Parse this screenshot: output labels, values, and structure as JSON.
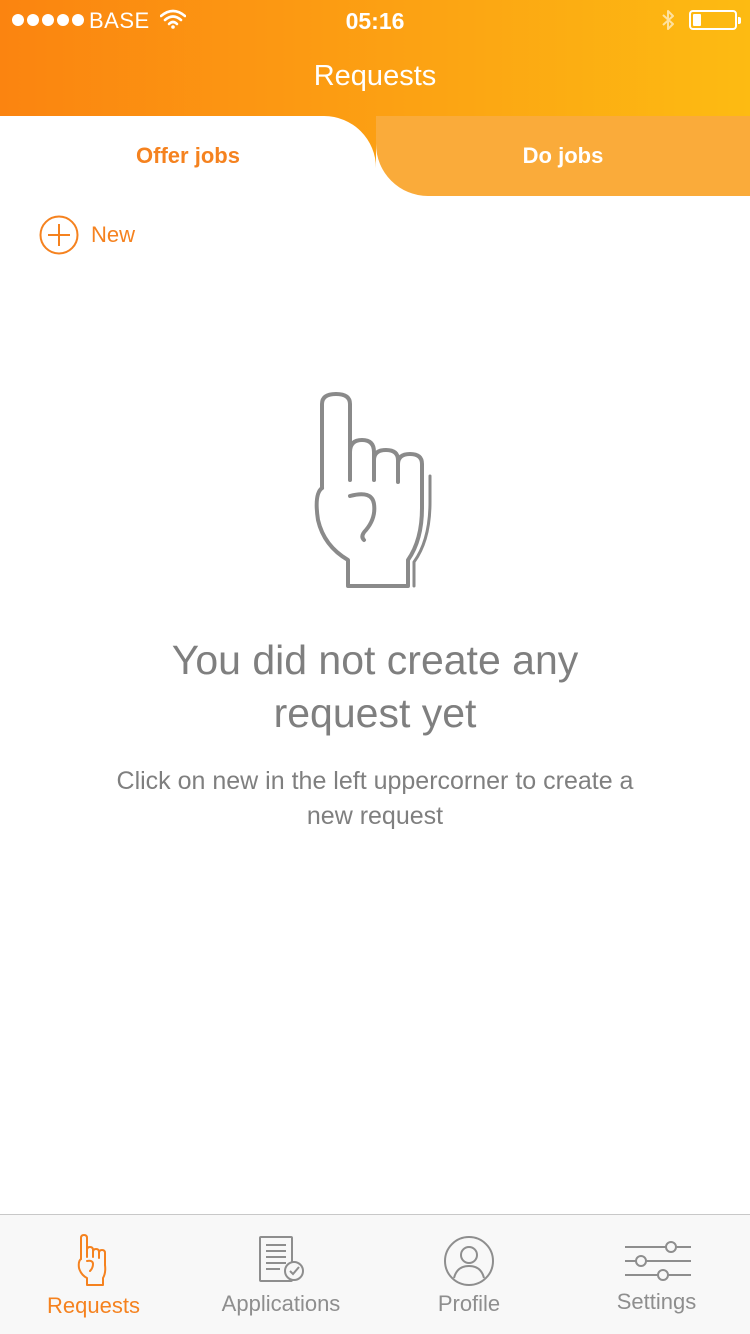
{
  "status_bar": {
    "carrier": "BASE",
    "time": "05:16",
    "battery_level": 0.2
  },
  "header": {
    "title": "Requests"
  },
  "tabs": [
    {
      "label": "Offer jobs",
      "active": true
    },
    {
      "label": "Do jobs",
      "active": false
    }
  ],
  "toolbar": {
    "new_label": "New",
    "new_icon": "plus-circle-icon"
  },
  "empty_state": {
    "icon": "pointing-hand-icon",
    "title": "You did not create any request yet",
    "subtitle": "Click on new in the left uppercorner to create a new request"
  },
  "tab_bar": {
    "items": [
      {
        "label": "Requests",
        "icon": "pointing-hand-icon",
        "active": true
      },
      {
        "label": "Applications",
        "icon": "document-check-icon",
        "active": false
      },
      {
        "label": "Profile",
        "icon": "person-icon",
        "active": false
      },
      {
        "label": "Settings",
        "icon": "sliders-icon",
        "active": false
      }
    ]
  },
  "colors": {
    "accent": "#f5821f",
    "header_gradient_start": "#fb8410",
    "header_gradient_end": "#fdbb12",
    "inactive_tab": "#faab3a",
    "muted_text": "#7f7f7f"
  }
}
